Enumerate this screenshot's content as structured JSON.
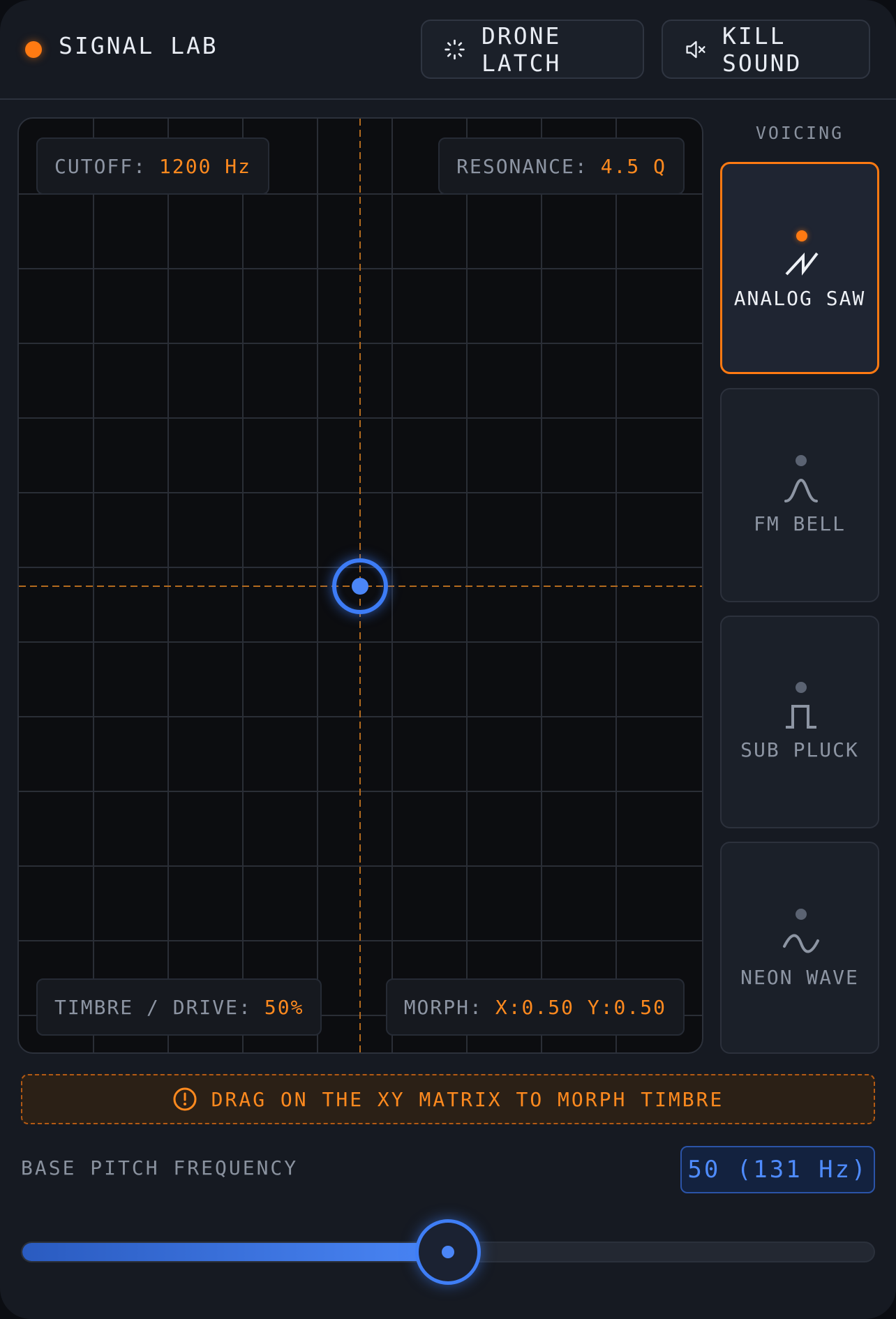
{
  "header": {
    "title": "SIGNAL LAB",
    "drone_label": "DRONE LATCH",
    "kill_label": "KILL SOUND"
  },
  "pad": {
    "cutoff_label": "CUTOFF:",
    "cutoff_value": "1200 Hz",
    "resonance_label": "RESONANCE:",
    "resonance_value": "4.5 Q",
    "timbre_label": "TIMBRE / DRIVE:",
    "timbre_value": "50%",
    "morph_label": "MORPH:",
    "morph_value": "X:0.50 Y:0.50",
    "puck_x": 0.5,
    "puck_y": 0.5
  },
  "voicing": {
    "label": "VOICING",
    "items": [
      {
        "name": "ANALOG SAW",
        "icon": "saw-wave-icon",
        "active": true
      },
      {
        "name": "FM BELL",
        "icon": "bell-curve-icon",
        "active": false
      },
      {
        "name": "SUB PLUCK",
        "icon": "square-pulse-icon",
        "active": false
      },
      {
        "name": "NEON WAVE",
        "icon": "sine-wave-icon",
        "active": false
      }
    ]
  },
  "hint": {
    "text": "DRAG ON THE XY MATRIX TO MORPH TIMBRE",
    "icon": "info-circle-icon"
  },
  "pitch": {
    "label": "BASE PITCH FREQUENCY",
    "value_text": "50 (131 Hz)",
    "fraction": 0.5
  },
  "colors": {
    "accent": "#ff7a12",
    "primary": "#3d7cf6",
    "background": "#161a22"
  }
}
